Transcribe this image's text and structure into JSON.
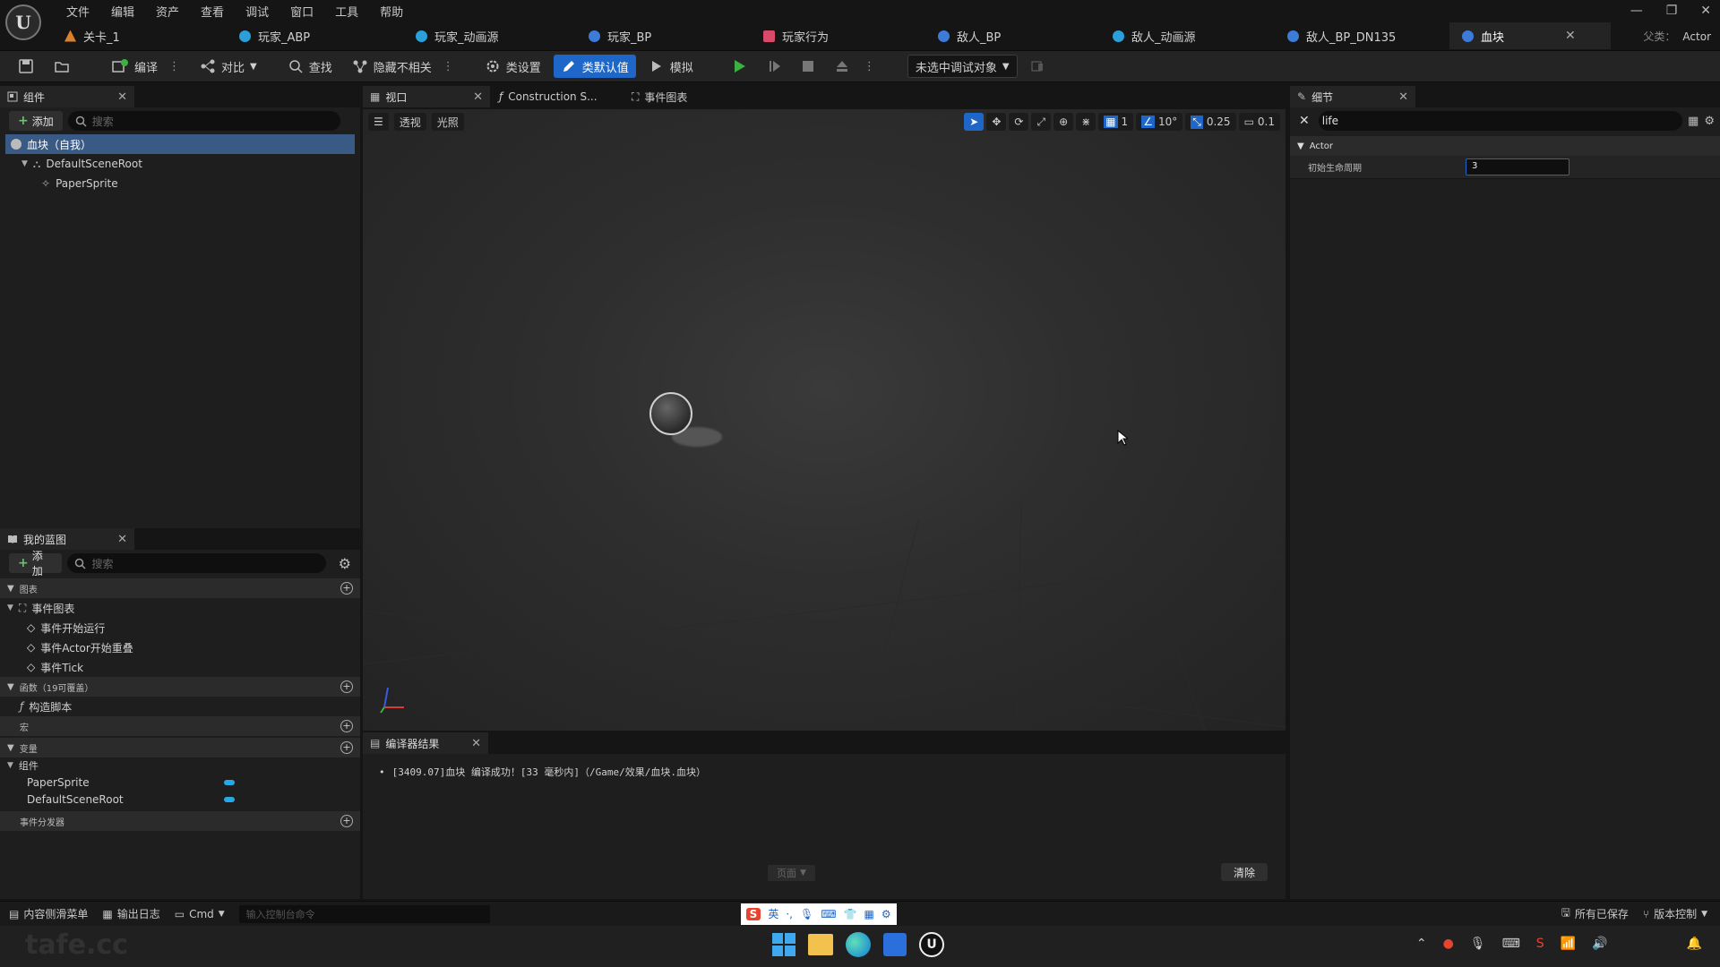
{
  "app": {
    "menu": [
      "文件",
      "编辑",
      "资产",
      "查看",
      "调试",
      "窗口",
      "工具",
      "帮助"
    ],
    "tabs": [
      {
        "label": "关卡_1",
        "color": "#d9822b"
      },
      {
        "label": "玩家_ABP",
        "color": "#2b9fd9"
      },
      {
        "label": "玩家_动画源",
        "color": "#2b9fd9"
      },
      {
        "label": "玩家_BP",
        "color": "#3d7bd9"
      },
      {
        "label": "玩家行为",
        "color": "#d94a6a"
      },
      {
        "label": "敌人_BP",
        "color": "#3d7bd9"
      },
      {
        "label": "敌人_动画源",
        "color": "#2b9fd9"
      },
      {
        "label": "敌人_BP_DN135",
        "color": "#3d7bd9"
      },
      {
        "label": "血块",
        "color": "#3d7bd9",
        "active": true
      }
    ],
    "parent_class_label": "父类：",
    "parent_class": "Actor",
    "window_controls": [
      "—",
      "❐",
      "✕"
    ]
  },
  "toolbar": {
    "compile": "编译",
    "diff": "对比",
    "find": "查找",
    "hide_unrelated": "隐藏不相关",
    "class_settings": "类设置",
    "class_defaults": "类默认值",
    "simulate": "模拟",
    "debug_target": "未选中调试对象"
  },
  "components_panel": {
    "title": "组件",
    "add": "添加",
    "search_placeholder": "搜索",
    "items": [
      "血块（自我）",
      "DefaultSceneRoot",
      "PaperSprite"
    ]
  },
  "my_blueprint": {
    "title": "我的蓝图",
    "add": "添加",
    "search_placeholder": "搜索",
    "graphs_header": "图表",
    "event_graph": "事件图表",
    "events": [
      "事件开始运行",
      "事件Actor开始重叠",
      "事件Tick"
    ],
    "functions_header": "函数（19可覆盖）",
    "construction_script": "构造脚本",
    "macros_header": "宏",
    "variables_header": "变量",
    "components_group": "组件",
    "variables": [
      "PaperSprite",
      "DefaultSceneRoot"
    ],
    "dispatchers_header": "事件分发器"
  },
  "center_tabs": {
    "viewport": "视口",
    "construction": "Construction S...",
    "event_graph": "事件图表"
  },
  "viewport": {
    "perspective": "透视",
    "lighting": "光照",
    "grid_snap": "1",
    "rotation_snap": "10°",
    "scale_snap": "0.25",
    "camera_speed": "0.1"
  },
  "compiler": {
    "title": "编译器结果",
    "log": "[3409.07]血块 编译成功！[33 毫秒内]（/Game/效果/血块.血块）",
    "page": "页面",
    "clear": "清除"
  },
  "details": {
    "title": "细节",
    "search_value": "life",
    "category": "Actor",
    "property_label": "初始生命周期",
    "property_value": "3"
  },
  "statusbar": {
    "content_drawer": "内容侧滑菜单",
    "output_log": "输出日志",
    "cmd": "Cmd",
    "console_placeholder": "输入控制台命令",
    "all_saved": "所有已保存",
    "source_control": "版本控制",
    "ime_lang": "英"
  },
  "watermark": "tafe.cc"
}
